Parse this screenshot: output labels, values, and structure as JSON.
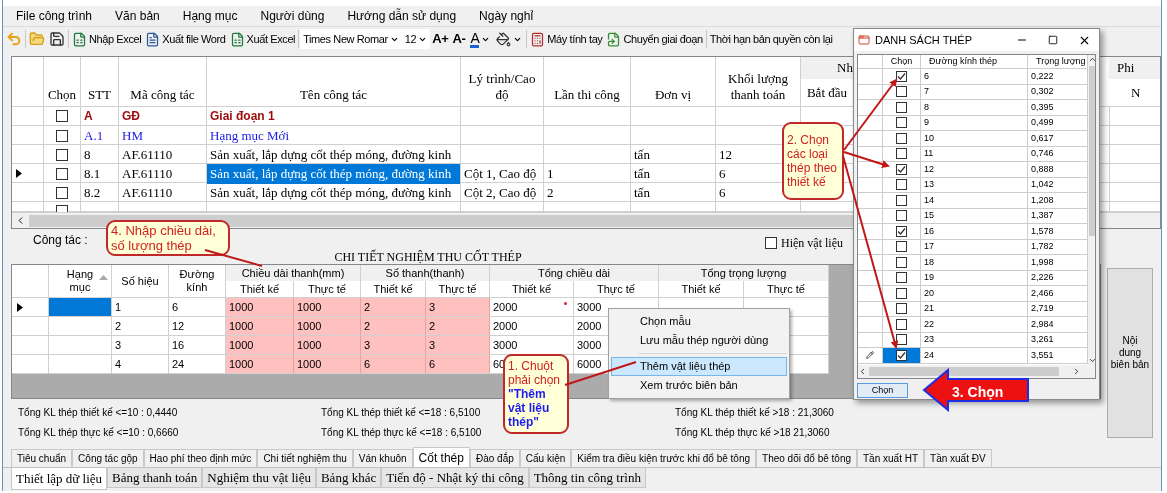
{
  "menu": [
    "File công trình",
    "Văn bản",
    "Hạng mục",
    "Người dùng",
    "Hướng dẫn sử dụng",
    "Ngày nghỉ"
  ],
  "toolbar": [
    {
      "kind": "icon"
    },
    {
      "kind": "separator"
    },
    {
      "kind": "icon"
    },
    {
      "kind": "icon"
    },
    {
      "kind": "separator"
    },
    {
      "kind": "button",
      "label": "Nhập Excel"
    },
    {
      "kind": "button",
      "label": "Xuất file Word"
    },
    {
      "kind": "button",
      "label": "Xuất Excel"
    },
    {
      "kind": "separator"
    },
    {
      "kind": "combo",
      "value": "Times New Romar"
    },
    {
      "kind": "combo",
      "value": "12"
    },
    {
      "kind": "glyph",
      "label": "A+"
    },
    {
      "kind": "glyph",
      "label": "A-"
    },
    {
      "kind": "glyph-dropdown",
      "label": "A"
    },
    {
      "kind": "icon-dropdown"
    },
    {
      "kind": "separator"
    },
    {
      "kind": "button",
      "label": "Máy tính tay"
    },
    {
      "kind": "button",
      "label": "Chuyển giai đoạn"
    },
    {
      "kind": "separator"
    },
    {
      "kind": "button",
      "label": "Thời hạn bản quyền còn lại"
    }
  ],
  "work_grid": {
    "columns": [
      "Chọn",
      "STT",
      "Mã công tác",
      "Tên công tác",
      "Lý trình/Cao độ",
      "Lần thi công",
      "Đơn vị",
      "Khối lượng thanh toán"
    ],
    "group_header": "Nh",
    "sub_header": "Bắt đầu",
    "right_group": "Phi",
    "right_sub": "N",
    "rows": [
      {
        "kind": "phase",
        "checked": false,
        "current": false,
        "selected": false,
        "stt": "A",
        "code": "GĐ",
        "name": "Giai đoạn 1"
      },
      {
        "kind": "category",
        "checked": false,
        "current": false,
        "selected": false,
        "stt": "A.1",
        "code": "HM",
        "name": "Hạng mục Mới"
      },
      {
        "kind": "task",
        "checked": false,
        "current": false,
        "selected": false,
        "stt": "8",
        "code": "AF.61110",
        "name": "Sản xuất, lắp dựng cốt thép móng, đường kinh",
        "unit": "tấn",
        "quantity": "12"
      },
      {
        "kind": "task",
        "checked": false,
        "current": true,
        "selected": true,
        "stt": "8.1",
        "code": "AF.61110",
        "name": "Sản xuất, lắp dựng cốt thép móng, đường kinh",
        "station": "Cột 1, Cao độ",
        "attempt": "1",
        "unit": "tấn",
        "quantity": "6"
      },
      {
        "kind": "task",
        "checked": false,
        "current": false,
        "selected": false,
        "stt": "8.2",
        "code": "AF.61110",
        "name": "Sản xuất, lắp dựng cốt thép móng, đường kinh",
        "station": "Cột 2, Cao độ",
        "attempt": "2",
        "unit": "tấn",
        "quantity": "6"
      },
      {
        "kind": "new",
        "checked": false,
        "current": false,
        "selected": false
      }
    ]
  },
  "detail": {
    "label": "Công tác :",
    "show_materials": {
      "label": "Hiện vật liệu",
      "checked": false
    },
    "title": "CHI TIẾT NGHIỆM THU CỐT THÉP",
    "columns": [
      "Hạng mục",
      "Số hiệu",
      "Đường kính"
    ],
    "groups": [
      {
        "label": "Chiều dài thanh(mm)",
        "subs": [
          "Thiết kế",
          "Thực tế"
        ]
      },
      {
        "label": "Số thanh(thanh)",
        "subs": [
          "Thiết kế",
          "Thực tế"
        ]
      },
      {
        "label": "Tổng chiều dài",
        "subs": [
          "Thiết kế",
          "Thực tế"
        ]
      },
      {
        "label": "Tổng trọng lượng",
        "subs": [
          "Thiết kế",
          "Thực tế"
        ]
      }
    ],
    "rows": [
      {
        "current": true,
        "selected": true,
        "flag": true,
        "number": "1",
        "diameter": "6",
        "length_design": "1000",
        "length_actual": "1000",
        "bars_design": "2",
        "bars_actual": "3",
        "total_design": "2000",
        "total_actual": "3000"
      },
      {
        "current": false,
        "selected": false,
        "flag": false,
        "number": "2",
        "diameter": "12",
        "length_design": "1000",
        "length_actual": "1000",
        "bars_design": "2",
        "bars_actual": "2",
        "total_design": "2000",
        "total_actual": "2000"
      },
      {
        "current": false,
        "selected": false,
        "flag": false,
        "number": "3",
        "diameter": "16",
        "length_design": "1000",
        "length_actual": "1000",
        "bars_design": "3",
        "bars_actual": "3",
        "total_design": "3000",
        "total_actual": "3000"
      },
      {
        "current": false,
        "selected": false,
        "number": "4",
        "diameter": "24",
        "length_design": "1000",
        "length_actual": "1000",
        "bars_design": "6",
        "bars_actual": "6",
        "total_design": "60",
        "total_actual": "6000"
      }
    ],
    "totals": [
      [
        "Tổng KL thép thiết kế <=10 : 0,4440",
        "Tổng KL thép thực kế <=10 : 0,6660"
      ],
      [
        "Tổng KL thép thiết kế <=18 : 6,5100",
        "Tổng KL thép thực kế <=18 : 6,5100"
      ],
      [
        "Tổng KL thép thiết kế >18 : 21,3060",
        "Tổng KL thép thực kế >18 21,3060"
      ]
    ],
    "side_button": "Nội dung biên bản"
  },
  "context_menu": [
    {
      "kind": "item",
      "label": "Chọn mẫu",
      "selected": false
    },
    {
      "kind": "item",
      "label": "Lưu mẫu thép người dùng",
      "selected": false
    },
    {
      "kind": "separator"
    },
    {
      "kind": "item",
      "label": "Thêm vật liệu thép",
      "selected": true
    },
    {
      "kind": "item",
      "label": "Xem trước biên bản",
      "selected": false
    }
  ],
  "tabs": [
    {
      "label": "Tiêu chuẩn",
      "selected": false
    },
    {
      "label": "Công tác gộp",
      "selected": false
    },
    {
      "label": "Hao phí theo định mức",
      "selected": false
    },
    {
      "label": "Chi tiết nghiệm thu",
      "selected": false
    },
    {
      "label": "Ván khuôn",
      "selected": false
    },
    {
      "label": "Cốt thép",
      "selected": true
    },
    {
      "label": "Đào đắp",
      "selected": false
    },
    {
      "label": "Cấu kiện",
      "selected": false
    },
    {
      "label": "Kiểm tra điều kiện trước khi đổ bê tông",
      "selected": false
    },
    {
      "label": "Theo dõi đổ bê tông",
      "selected": false
    },
    {
      "label": "Tần xuất HT",
      "selected": false
    },
    {
      "label": "Tần xuất ĐV",
      "selected": false
    }
  ],
  "main_tabs": [
    {
      "label": "Thiết lập dữ liệu",
      "selected": true
    },
    {
      "label": "Bảng thanh toán",
      "selected": false
    },
    {
      "label": "Nghiệm thu vật liệu",
      "selected": false
    },
    {
      "label": "Bảng khác",
      "selected": false
    },
    {
      "label": "Tiến độ - Nhật ký thi công",
      "selected": false
    },
    {
      "label": "Thông tin công trình",
      "selected": false
    }
  ],
  "dialog": {
    "title": "DANH SÁCH THÉP",
    "columns": [
      "Chọn",
      "Đường kính thép",
      "Trọng lượng"
    ],
    "rows": [
      {
        "diameter": "6",
        "weight": "0,222",
        "checked": true,
        "selected": false,
        "editing": false
      },
      {
        "diameter": "7",
        "weight": "0,302",
        "checked": false,
        "selected": false,
        "editing": false
      },
      {
        "diameter": "8",
        "weight": "0,395",
        "checked": false,
        "selected": false,
        "editing": false
      },
      {
        "diameter": "9",
        "weight": "0,499",
        "checked": false,
        "selected": false,
        "editing": false
      },
      {
        "diameter": "10",
        "weight": "0,617",
        "checked": false,
        "selected": false,
        "editing": false
      },
      {
        "diameter": "11",
        "weight": "0,746",
        "checked": false,
        "selected": false,
        "editing": false
      },
      {
        "diameter": "12",
        "weight": "0,888",
        "checked": true,
        "selected": false,
        "editing": false
      },
      {
        "diameter": "13",
        "weight": "1,042",
        "checked": false,
        "selected": false,
        "editing": false
      },
      {
        "diameter": "14",
        "weight": "1,208",
        "checked": false,
        "selected": false,
        "editing": false
      },
      {
        "diameter": "15",
        "weight": "1,387",
        "checked": false,
        "selected": false,
        "editing": false
      },
      {
        "diameter": "16",
        "weight": "1,578",
        "checked": true,
        "selected": false,
        "editing": false
      },
      {
        "diameter": "17",
        "weight": "1,782",
        "checked": false,
        "selected": false,
        "editing": false
      },
      {
        "diameter": "18",
        "weight": "1,998",
        "checked": false,
        "selected": false,
        "editing": false
      },
      {
        "diameter": "19",
        "weight": "2,226",
        "checked": false,
        "selected": false,
        "editing": false
      },
      {
        "diameter": "20",
        "weight": "2,466",
        "checked": false,
        "selected": false,
        "editing": false
      },
      {
        "diameter": "21",
        "weight": "2,719",
        "checked": false,
        "selected": false,
        "editing": false
      },
      {
        "diameter": "22",
        "weight": "2,984",
        "checked": false,
        "selected": false,
        "editing": false
      },
      {
        "diameter": "23",
        "weight": "3,261",
        "checked": false,
        "selected": false,
        "editing": false
      },
      {
        "diameter": "24",
        "weight": "3,551",
        "checked": true,
        "selected": true,
        "editing": true
      }
    ],
    "button": "Chọn"
  },
  "callouts": [
    {
      "kind": "bubble",
      "text": "4. Nhập chiều dài, số lượng thép"
    },
    {
      "kind": "bubble",
      "text": "2. Chọn các loại thép theo thiết kế"
    },
    {
      "kind": "bubble",
      "text": "1. Chuột phải chọn",
      "emphasis": "\"Thêm vật liệu thép\""
    },
    {
      "kind": "arrow",
      "text": "3. Chọn"
    }
  ]
}
